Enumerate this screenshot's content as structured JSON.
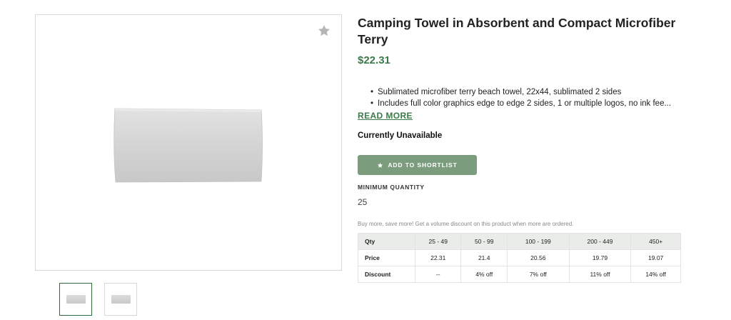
{
  "product": {
    "title": "Camping Towel in Absorbent and Compact Microfiber Terry",
    "price": "$22.31",
    "features": [
      "Sublimated microfiber terry beach towel, 22x44, sublimated 2 sides",
      "Includes full color graphics edge to edge 2 sides, 1 or multiple logos, no ink fee..."
    ],
    "read_more": "READ MORE",
    "availability": "Currently Unavailable",
    "shortlist_label": "ADD TO SHORTLIST",
    "min_qty_label": "MINIMUM QUANTITY",
    "min_qty_value": "25",
    "discount_note": "Buy more, save more! Get a volume discount on this product when more are ordered."
  },
  "pricing_table": {
    "headers": [
      "Qty",
      "25 - 49",
      "50 - 99",
      "100 - 199",
      "200 - 449",
      "450+"
    ],
    "price_row": [
      "Price",
      "22.31",
      "21.4",
      "20.56",
      "19.79",
      "19.07"
    ],
    "discount_row": [
      "Discount",
      "--",
      "4% off",
      "7% off",
      "11% off",
      "14% off"
    ]
  },
  "icons": {
    "favorite": "star-icon",
    "shortlist": "star-icon"
  },
  "colors": {
    "accent": "#3b7a48",
    "button": "#7b9d7e",
    "table_header": "#e9ece9"
  }
}
